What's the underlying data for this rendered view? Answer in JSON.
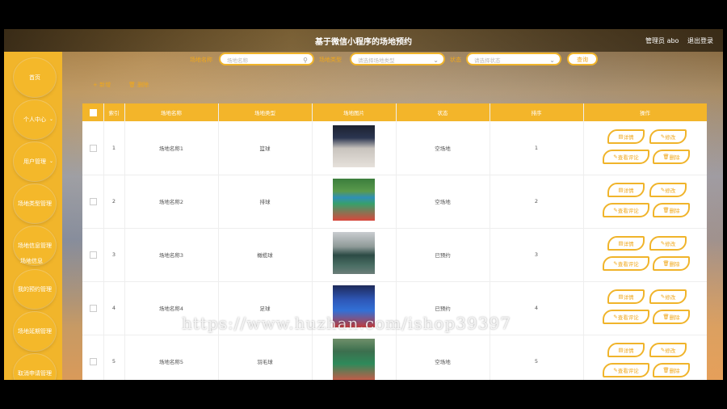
{
  "header": {
    "title": "基于微信小程序的场地预约",
    "user_label": "管理员 abo",
    "logout_label": "退出登录"
  },
  "sidebar": {
    "items": [
      {
        "label": "首页"
      },
      {
        "label": "个人中心",
        "chevron": "chevron-down"
      },
      {
        "label": "用户管理",
        "chevron": "chevron-down"
      },
      {
        "label": "场地类型管理"
      },
      {
        "label": "场地信息管理",
        "sub": "场地信息"
      },
      {
        "label": "我的预约管理"
      },
      {
        "label": "场地延期管理"
      },
      {
        "label": "取消申请管理"
      }
    ]
  },
  "filters": {
    "name_label": "场地名称",
    "name_placeholder": "场地名称",
    "search_icon": "search-icon",
    "type_label": "场地类型",
    "type_placeholder": "请选择场地类型",
    "status_label": "状态",
    "status_placeholder": "请选择状态",
    "query_button": "查询"
  },
  "toolbar": {
    "add_label": "+ 新增",
    "delete_label": "删除"
  },
  "table": {
    "columns": [
      "",
      "索引",
      "场地名称",
      "场地类型",
      "场地图片",
      "状态",
      "排序",
      "操作"
    ],
    "rows": [
      {
        "index": "1",
        "name": "场地名称1",
        "type": "篮球",
        "status": "空场地",
        "sort": "1",
        "pic": "indoor-court"
      },
      {
        "index": "2",
        "name": "场地名称2",
        "type": "排球",
        "status": "空场地",
        "sort": "2",
        "pic": "outdoor-court"
      },
      {
        "index": "3",
        "name": "场地名称3",
        "type": "橄榄球",
        "status": "已预约",
        "sort": "3",
        "pic": "wet-court"
      },
      {
        "index": "4",
        "name": "场地名称4",
        "type": "足球",
        "status": "已预约",
        "sort": "4",
        "pic": "blue-court"
      },
      {
        "index": "5",
        "name": "场地名称5",
        "type": "羽毛球",
        "status": "空场地",
        "sort": "5",
        "pic": "green-court"
      }
    ],
    "row_actions": {
      "detail": "详情",
      "edit": "修改",
      "review": "查看评论",
      "delete": "删除"
    }
  },
  "watermark": "https://www.huzhan.com/ishop39397",
  "colors": {
    "accent": "#f3b52a",
    "accent_text": "#f0a81c"
  }
}
